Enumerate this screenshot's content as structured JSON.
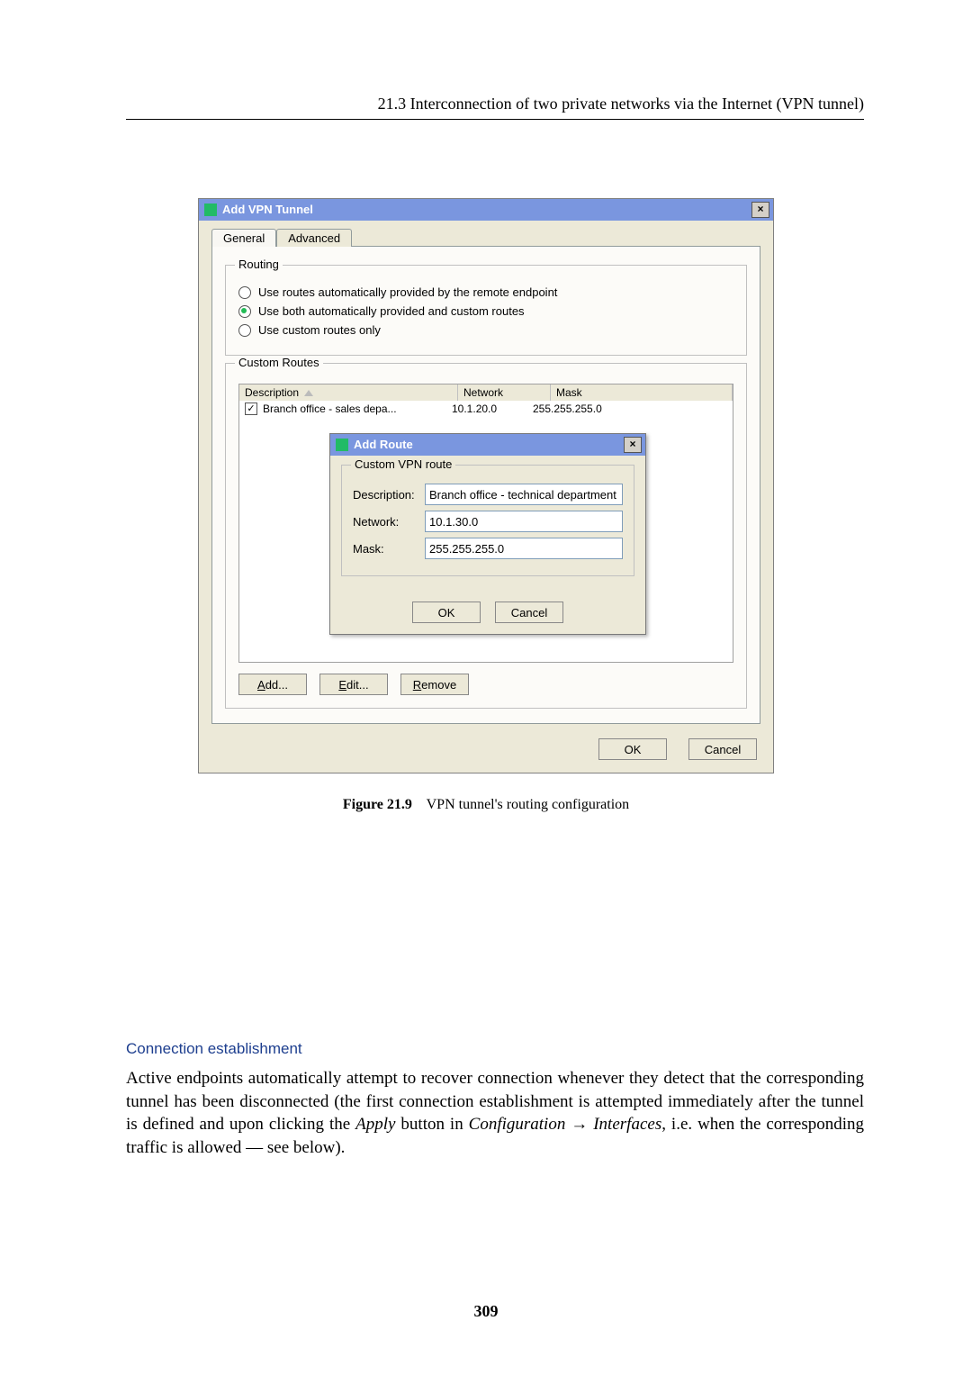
{
  "header": "21.3  Interconnection of two private networks via the Internet (VPN tunnel)",
  "dialog": {
    "title": "Add VPN Tunnel",
    "close_glyph": "×",
    "tabs": {
      "general": "General",
      "advanced": "Advanced",
      "active": "Advanced"
    },
    "routing": {
      "legend": "Routing",
      "opt_remote": "Use routes automatically provided by the remote endpoint",
      "opt_both": "Use both automatically provided and custom routes",
      "opt_custom": "Use custom routes only",
      "selected": "both"
    },
    "custom_routes": {
      "legend": "Custom Routes",
      "columns": {
        "desc": "Description",
        "net": "Network",
        "mask": "Mask"
      },
      "rows": [
        {
          "checked": true,
          "desc": "Branch office - sales depa...",
          "net": "10.1.20.0",
          "mask": "255.255.255.0"
        }
      ],
      "buttons": {
        "add": "Add...",
        "edit": "Edit...",
        "remove": "Remove"
      }
    },
    "ok": "OK",
    "cancel": "Cancel"
  },
  "add_route": {
    "title": "Add Route",
    "group_legend": "Custom VPN route",
    "labels": {
      "desc": "Description:",
      "net": "Network:",
      "mask": "Mask:"
    },
    "values": {
      "desc": "Branch office - technical department",
      "net": "10.1.30.0",
      "mask": "255.255.255.0"
    },
    "ok": "OK",
    "cancel": "Cancel",
    "close_glyph": "×"
  },
  "figure": {
    "label": "Figure 21.9",
    "caption": "VPN tunnel's routing configuration"
  },
  "section": {
    "heading": "Connection establishment",
    "p_before_apply": "Active endpoints automatically attempt to recover connection whenever they detect that the corresponding tunnel has been disconnected (the first connection establishment is attempted immediately after the tunnel is defined and upon clicking the ",
    "apply": "Apply",
    "p_mid": " button in ",
    "config": "Configuration",
    "arrow": " → ",
    "interfaces": "Interfaces",
    "p_tail": ", i.e. when the corresponding traffic is allowed — see below)."
  },
  "page_number": "309"
}
